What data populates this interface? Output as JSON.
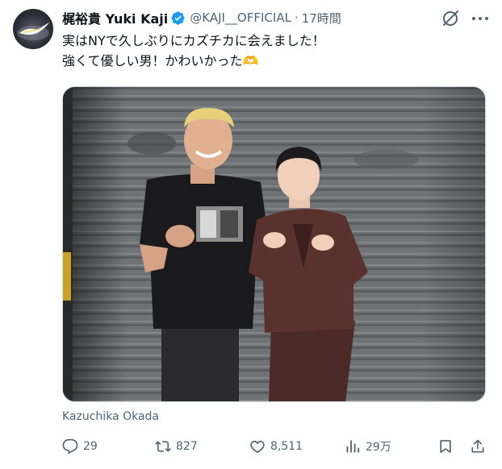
{
  "tweet": {
    "author": {
      "display_name": "梶裕貴 Yuki Kaji",
      "handle": "@KAJI__OFFICIAL",
      "verified": true,
      "avatar": "avatar-icon"
    },
    "separator": "·",
    "timestamp": "17時間",
    "text_lines": [
      "実はNYで久しぶりにカズチカに会えました！",
      "強くて優しい男！かわいかった🫶"
    ],
    "media": {
      "alt_button_icon": "image-edit-icon"
    },
    "tagged_user": "Kazuchika Okada",
    "actions": {
      "replies": "29",
      "retweets": "827",
      "likes": "8,511",
      "views": "29万"
    },
    "icons": {
      "grok": "grok-icon",
      "more": "more-icon",
      "reply": "reply-icon",
      "retweet": "retweet-icon",
      "like": "heart-icon",
      "views": "views-icon",
      "bookmark": "bookmark-icon",
      "share": "share-icon"
    },
    "colors": {
      "text": "#0f1419",
      "secondary": "#536471",
      "verified": "#1d9bf0",
      "heart_emoji": "#ffcc4d"
    }
  }
}
